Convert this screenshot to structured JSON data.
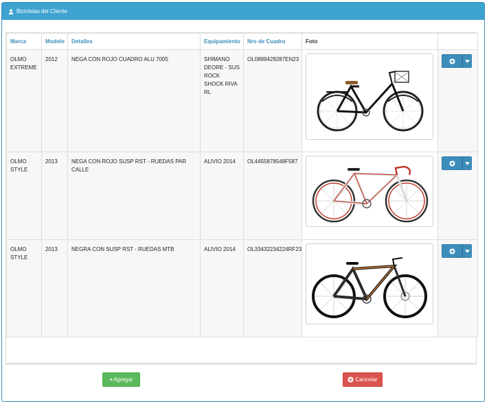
{
  "panel": {
    "title": "Bicicletas del Cliente",
    "icon": "user-icon"
  },
  "table": {
    "headers": [
      "Marca",
      "Modelo",
      "Detalles",
      "Equipamiento",
      "Nro de Cuadro",
      "Foto"
    ],
    "rows": [
      {
        "marca": "OLMO EXTREME",
        "modelo": "2012",
        "detalles": "NEGA CON ROJO CUADRO ALU 7005",
        "equipamiento": "SHIMANO DEORE - SUS ROCK SHOCK RIVA RL",
        "cuadro": "OL0889429287EN23",
        "foto": "city-bike-black-with-basket"
      },
      {
        "marca": "OLMO STYLE",
        "modelo": "2013",
        "detalles": "NEGA CON ROJO SUSP RST - RUEDAS PAR CALLE",
        "equipamiento": "ALIVIO 2014",
        "cuadro": "OL4455878548F587",
        "foto": "road-bike-white-red"
      },
      {
        "marca": "OLMO STYLE",
        "modelo": "2013",
        "detalles": "NEGRA CON SUSP RST - RUEDAS MTB",
        "equipamiento": "ALIVIO 2014",
        "cuadro": "OL33432234224RF23",
        "foto": "hybrid-bike-black-orange"
      }
    ]
  },
  "actions": {
    "add_label": "Agregar",
    "add_icon": "plus-icon",
    "cancel_label": "Cancelar",
    "cancel_icon": "close-circle-icon"
  },
  "colors": {
    "primary": "#3c8dbc",
    "header": "#3ea3d0",
    "success": "#5cb85c",
    "danger": "#d9534f"
  }
}
